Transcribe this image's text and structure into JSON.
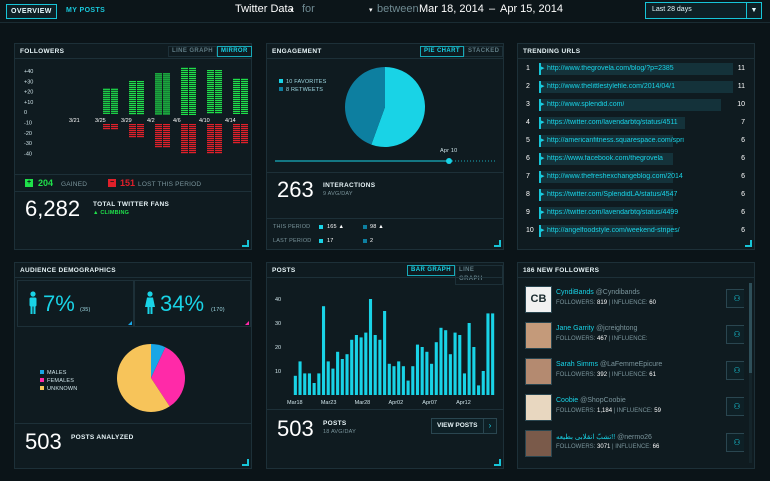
{
  "tabs": {
    "overview": "OVERVIEW",
    "my_posts": "MY POSTS"
  },
  "header": {
    "title": "Twitter Data",
    "for": "for",
    "between": "between",
    "date_start": "Mar 18, 2014",
    "dash": "–",
    "date_end": "Apr 15, 2014"
  },
  "date_select": {
    "value": "Last 28 days"
  },
  "followers": {
    "title": "FOLLOWERS",
    "toggle_line": "LINE GRAPH",
    "toggle_mirror": "MIRROR",
    "yticks": [
      "+40",
      "+30",
      "+20",
      "+10",
      "0",
      "-10",
      "-20",
      "-30",
      "-40"
    ],
    "xlabels": [
      "3/21",
      "3/25",
      "3/29",
      "4/2",
      "4/6",
      "4/10",
      "4/14"
    ],
    "gained_value": "204",
    "gained_label": "GAINED",
    "lost_value": "151",
    "lost_label": "LOST THIS PERIOD",
    "total": "6,282",
    "total_label": "TOTAL TWITTER FANS",
    "trend": "▲ CLIMBING",
    "colors": {
      "gain": "#1fe04a",
      "loss": "#e0202a"
    }
  },
  "engagement": {
    "title": "ENGAGEMENT",
    "toggle_pie": "PIE CHART",
    "toggle_stacked": "STACKED",
    "legend": [
      {
        "label": "10 FAVORITES",
        "color": "#19d3e6"
      },
      {
        "label": "8 RETWEETS",
        "color": "#0d7fa0"
      }
    ],
    "slider_label": "Apr 10",
    "interactions": "263",
    "interactions_label": "INTERACTIONS",
    "avg": "9 AVG/DAY",
    "this_period_label": "THIS PERIOD",
    "last_period_label": "LAST PERIOD",
    "this_a": "165 ▲",
    "this_b": "98 ▲",
    "last_a": "17",
    "last_b": "2"
  },
  "trending": {
    "title": "TRENDING URLS",
    "rows": [
      {
        "idx": "1",
        "url": "http://www.thegrovela.com/blog/?p=2385",
        "count": "11"
      },
      {
        "idx": "2",
        "url": "http://www.thelittlestylefile.com/2014/04/1",
        "count": "11"
      },
      {
        "idx": "3",
        "url": "http://www.splendid.com/",
        "count": "10"
      },
      {
        "idx": "4",
        "url": "https://twitter.com/lavendarbtq/status/4511",
        "count": "7"
      },
      {
        "idx": "5",
        "url": "http://americanfitness.squarespace.com/spri",
        "count": "6"
      },
      {
        "idx": "6",
        "url": "https://www.facebook.com/thegrovela",
        "count": "6"
      },
      {
        "idx": "7",
        "url": "http://www.thefreshexchangeblog.com/2014",
        "count": "6"
      },
      {
        "idx": "8",
        "url": "https://twitter.com/SplendidLA/status/4547",
        "count": "6"
      },
      {
        "idx": "9",
        "url": "https://twitter.com/lavendarbtq/status/4499",
        "count": "6"
      },
      {
        "idx": "10",
        "url": "http://angelfoodstyle.com/weekend-stripes/",
        "count": "6"
      }
    ]
  },
  "audience": {
    "title": "AUDIENCE DEMOGRAPHICS",
    "male_pct": "7%",
    "male_count": "(35)",
    "female_pct": "34%",
    "female_count": "(170)",
    "legend": [
      {
        "label": "MALES",
        "color": "#19a6e6"
      },
      {
        "label": "FEMALES",
        "color": "#ff2aa8"
      },
      {
        "label": "UNKNOWN",
        "color": "#f7c45a"
      }
    ],
    "posts": "503",
    "posts_label": "POSTS ANALYZED"
  },
  "posts": {
    "title": "POSTS",
    "toggle_bar": "BAR GRAPH",
    "toggle_line": "LINE GRAPH",
    "total": "503",
    "label": "POSTS",
    "avg": "18 AVG/DAY",
    "button": "VIEW POSTS"
  },
  "followers_list": {
    "title": "186 NEW FOLLOWERS",
    "stat_followers": "FOLLOWERS:",
    "stat_influence": "INFLUENCE:",
    "rows": [
      {
        "name": "CyndiBands",
        "handle": "@Cyndibands",
        "followers": "819",
        "influence": "60",
        "avatar": "CB"
      },
      {
        "name": "Jane Garrity",
        "handle": "@jcreightong",
        "followers": "467",
        "influence": "",
        "avatar": ""
      },
      {
        "name": "Sarah Simms",
        "handle": "@LaFemmeEpicure",
        "followers": "392",
        "influence": "61",
        "avatar": ""
      },
      {
        "name": "Coobie",
        "handle": "@ShopCoobie",
        "followers": "1,184",
        "influence": "59",
        "avatar": ""
      },
      {
        "name": "تشبّ انقلابی بطيعه!!",
        "handle": "@nermo26",
        "followers": "3071",
        "influence": "66",
        "avatar": ""
      }
    ]
  },
  "chart_data": [
    {
      "type": "bar",
      "title": "FOLLOWERS",
      "categories": [
        "d1",
        "d2",
        "d3",
        "d4",
        "d5",
        "d6",
        "d7",
        "d8",
        "d9",
        "d10",
        "d11",
        "d12",
        "d13",
        "d14"
      ],
      "xlabels": [
        "3/21",
        "3/25",
        "3/29",
        "4/2",
        "4/6",
        "4/10",
        "4/14"
      ],
      "series": [
        {
          "name": "GAINED",
          "values": [
            0,
            0,
            23,
            23,
            30,
            30,
            37,
            37,
            42,
            42,
            40,
            40,
            32,
            32
          ]
        },
        {
          "name": "LOST THIS PERIOD",
          "values": [
            0,
            0,
            -4,
            -4,
            -12,
            -12,
            -21,
            -21,
            -27,
            -27,
            -26,
            -26,
            -17,
            -17
          ]
        }
      ],
      "ylim": [
        -40,
        40
      ]
    },
    {
      "type": "pie",
      "title": "ENGAGEMENT",
      "labels": [
        "FAVORITES",
        "RETWEETS"
      ],
      "values": [
        10,
        8
      ]
    },
    {
      "type": "pie",
      "title": "AUDIENCE DEMOGRAPHICS",
      "labels": [
        "MALES",
        "FEMALES",
        "UNKNOWN"
      ],
      "values": [
        35,
        170,
        298
      ]
    },
    {
      "type": "bar",
      "title": "POSTS",
      "xlabels": [
        "Mar18",
        "Mar23",
        "Mar28",
        "Apr02",
        "Apr07",
        "Apr12"
      ],
      "values": [
        8,
        14,
        9,
        9,
        5,
        9,
        37,
        14,
        11,
        18,
        15,
        17,
        23,
        25,
        24,
        26,
        40,
        25,
        23,
        35,
        13,
        12,
        14,
        12,
        6,
        12,
        21,
        20,
        18,
        13,
        22,
        28,
        27,
        17,
        26,
        25,
        9,
        30,
        20,
        4,
        10,
        34,
        34
      ],
      "ylim": [
        0,
        45
      ],
      "yticks": [
        10,
        20,
        30,
        40
      ]
    }
  ]
}
